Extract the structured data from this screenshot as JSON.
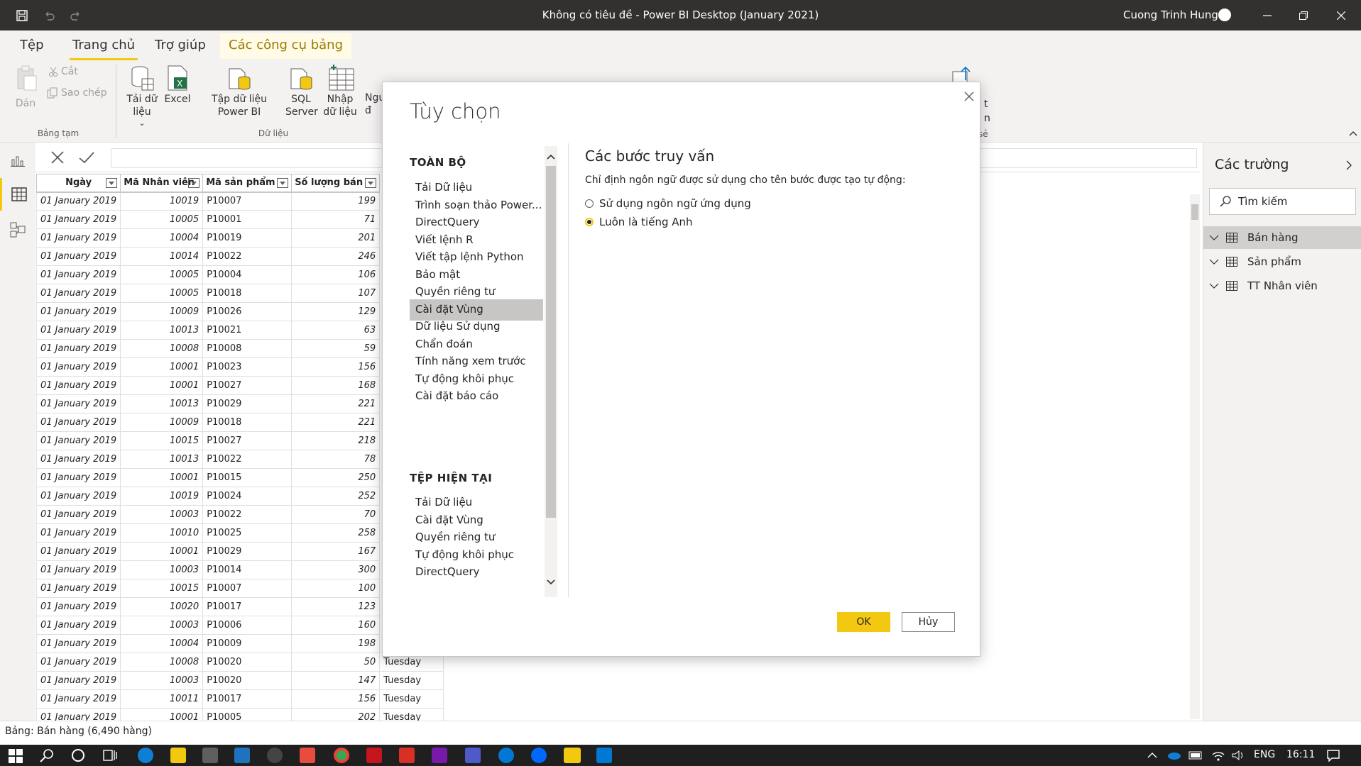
{
  "window": {
    "title": "Không có tiêu đề - Power BI Desktop (January 2021)",
    "user": "Cuong Trinh Hung"
  },
  "tabs": [
    {
      "label": "Tệp"
    },
    {
      "label": "Trang chủ"
    },
    {
      "label": "Trợ giúp"
    },
    {
      "label": "Các công cụ bảng"
    }
  ],
  "ribbon": {
    "paste": "Dán",
    "cut": "Cắt",
    "copy": "Sao chép",
    "group_clipboard": "Bảng tạm",
    "get_data": "Tải dữ liệu",
    "excel": "Excel",
    "pbi_dataset": "Tập dữ liệu Power BI",
    "sql_server": "SQL Server",
    "enter_data": "Nhập dữ liệu",
    "group_data": "Dữ liệu",
    "partial_1": "Ngu",
    "partial_2": "đ",
    "partial_3": "t",
    "partial_4": "n",
    "partial_5": "sẻ"
  },
  "table": {
    "headers": [
      "Ngày",
      "Mã Nhân viên",
      "Mã sản phẩm",
      "Số lượng bán"
    ],
    "rows": [
      [
        "01 January 2019",
        "10019",
        "P10007",
        "199",
        ""
      ],
      [
        "01 January 2019",
        "10005",
        "P10001",
        "71",
        ""
      ],
      [
        "01 January 2019",
        "10004",
        "P10019",
        "201",
        ""
      ],
      [
        "01 January 2019",
        "10014",
        "P10022",
        "246",
        ""
      ],
      [
        "01 January 2019",
        "10005",
        "P10004",
        "106",
        ""
      ],
      [
        "01 January 2019",
        "10005",
        "P10018",
        "107",
        ""
      ],
      [
        "01 January 2019",
        "10009",
        "P10026",
        "129",
        ""
      ],
      [
        "01 January 2019",
        "10013",
        "P10021",
        "63",
        ""
      ],
      [
        "01 January 2019",
        "10008",
        "P10008",
        "59",
        ""
      ],
      [
        "01 January 2019",
        "10001",
        "P10023",
        "156",
        ""
      ],
      [
        "01 January 2019",
        "10001",
        "P10027",
        "168",
        ""
      ],
      [
        "01 January 2019",
        "10013",
        "P10029",
        "221",
        ""
      ],
      [
        "01 January 2019",
        "10009",
        "P10018",
        "221",
        ""
      ],
      [
        "01 January 2019",
        "10015",
        "P10027",
        "218",
        ""
      ],
      [
        "01 January 2019",
        "10013",
        "P10022",
        "78",
        ""
      ],
      [
        "01 January 2019",
        "10001",
        "P10015",
        "250",
        ""
      ],
      [
        "01 January 2019",
        "10019",
        "P10024",
        "252",
        ""
      ],
      [
        "01 January 2019",
        "10003",
        "P10022",
        "70",
        ""
      ],
      [
        "01 January 2019",
        "10010",
        "P10025",
        "258",
        ""
      ],
      [
        "01 January 2019",
        "10001",
        "P10029",
        "167",
        ""
      ],
      [
        "01 January 2019",
        "10003",
        "P10014",
        "300",
        ""
      ],
      [
        "01 January 2019",
        "10015",
        "P10007",
        "100",
        ""
      ],
      [
        "01 January 2019",
        "10020",
        "P10017",
        "123",
        ""
      ],
      [
        "01 January 2019",
        "10003",
        "P10006",
        "160",
        ""
      ],
      [
        "01 January 2019",
        "10004",
        "P10009",
        "198",
        ""
      ],
      [
        "01 January 2019",
        "10008",
        "P10020",
        "50",
        "Tuesday"
      ],
      [
        "01 January 2019",
        "10003",
        "P10020",
        "147",
        "Tuesday"
      ],
      [
        "01 January 2019",
        "10011",
        "P10017",
        "156",
        "Tuesday"
      ],
      [
        "01 January 2019",
        "10001",
        "P10005",
        "202",
        "Tuesday"
      ]
    ]
  },
  "fields": {
    "title": "Các trường",
    "search_placeholder": "Tìm kiếm",
    "tables": [
      {
        "name": "Bán hàng"
      },
      {
        "name": "Sản phẩm"
      },
      {
        "name": "TT Nhân viên"
      }
    ]
  },
  "status": {
    "text": "Bảng: Bán hàng (6,490 hàng)"
  },
  "taskbar": {
    "lang": "ENG",
    "time": "16:11"
  },
  "dialog": {
    "title": "Tùy chọn",
    "section_global": "TOÀN BỘ",
    "global_items": [
      "Tải Dữ liệu",
      "Trình soạn thảo Power...",
      "DirectQuery",
      "Viết lệnh R",
      "Viết tập lệnh Python",
      "Bảo mật",
      "Quyền riêng tư",
      "Cài đặt Vùng",
      "Dữ liệu Sử dụng",
      "Chẩn đoán",
      "Tính năng xem trước",
      "Tự động khôi phục",
      "Cài đặt báo cáo"
    ],
    "section_current": "TỆP HIỆN TẠI",
    "current_items": [
      "Tải Dữ liệu",
      "Cài đặt Vùng",
      "Quyền riêng tư",
      "Tự động khôi phục",
      "DirectQuery"
    ],
    "content_title": "Các bước truy vấn",
    "content_desc": "Chỉ định ngôn ngữ được sử dụng cho tên bước được tạo tự động:",
    "option_app_lang": "Sử dụng ngôn ngữ ứng dụng",
    "option_english": "Luôn là tiếng Anh",
    "ok": "OK",
    "cancel": "Hủy"
  },
  "colors": {
    "accent": "#f2c811",
    "titlebar": "#323130"
  }
}
